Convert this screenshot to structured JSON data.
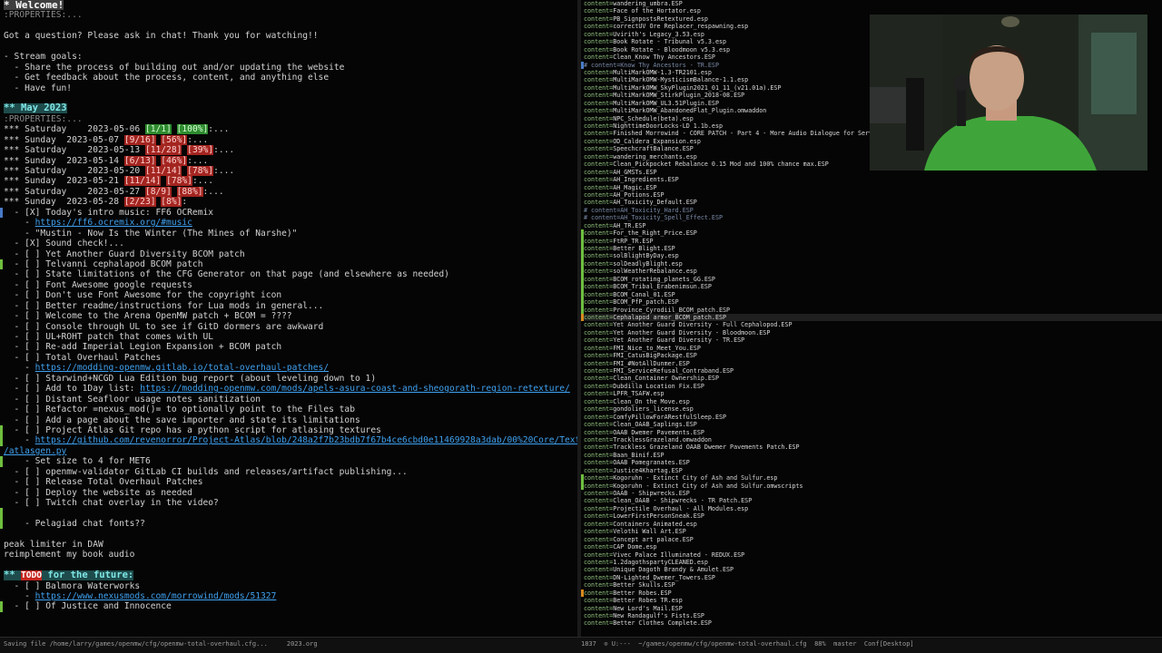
{
  "left": {
    "lines": [
      {
        "parts": [
          {
            "t": "* Welcome!",
            "c": "h1"
          }
        ]
      },
      {
        "parts": [
          {
            "t": ":PROPERTIES:...",
            "c": "dim"
          }
        ]
      },
      {
        "parts": [
          {
            "t": ""
          }
        ]
      },
      {
        "parts": [
          {
            "t": "Got a question? Please ask in chat! Thank you for watching!!"
          }
        ]
      },
      {
        "parts": [
          {
            "t": ""
          }
        ]
      },
      {
        "parts": [
          {
            "t": "- Stream goals:"
          }
        ]
      },
      {
        "parts": [
          {
            "t": "  - Share the process of building out and/or updating the website"
          }
        ]
      },
      {
        "parts": [
          {
            "t": "  - Get feedback about the process, content, and anything else"
          }
        ]
      },
      {
        "parts": [
          {
            "t": "  - Have fun!"
          }
        ]
      },
      {
        "parts": [
          {
            "t": ""
          }
        ]
      },
      {
        "parts": [
          {
            "t": "** May 2023",
            "c": "h2"
          }
        ]
      },
      {
        "parts": [
          {
            "t": ":PROPERTIES:...",
            "c": "dim"
          }
        ]
      },
      {
        "parts": [
          {
            "t": "*** Saturday    2023-05-06 "
          },
          {
            "t": "[1/1]",
            "c": "pct-good"
          },
          {
            "t": " "
          },
          {
            "t": "[100%]",
            "c": "pct-good"
          },
          {
            "t": ":..."
          }
        ]
      },
      {
        "parts": [
          {
            "t": "*** Sunday  2023-05-07 "
          },
          {
            "t": "[9/16]",
            "c": "pct-bad"
          },
          {
            "t": " "
          },
          {
            "t": "[56%]",
            "c": "pct-bad"
          },
          {
            "t": ":..."
          }
        ]
      },
      {
        "parts": [
          {
            "t": "*** Saturday    2023-05-13 "
          },
          {
            "t": "[11/28]",
            "c": "pct-bad"
          },
          {
            "t": " "
          },
          {
            "t": "[39%]",
            "c": "pct-bad"
          },
          {
            "t": ":..."
          }
        ]
      },
      {
        "parts": [
          {
            "t": "*** Sunday  2023-05-14 "
          },
          {
            "t": "[6/13]",
            "c": "pct-bad"
          },
          {
            "t": " "
          },
          {
            "t": "[46%]",
            "c": "pct-bad"
          },
          {
            "t": ":..."
          }
        ]
      },
      {
        "parts": [
          {
            "t": "*** Saturday    2023-05-20 "
          },
          {
            "t": "[11/14]",
            "c": "pct-bad"
          },
          {
            "t": " "
          },
          {
            "t": "[78%]",
            "c": "pct-bad"
          },
          {
            "t": ":..."
          }
        ]
      },
      {
        "parts": [
          {
            "t": "*** Sunday  2023-05-21 "
          },
          {
            "t": "[11/14]",
            "c": "pct-bad"
          },
          {
            "t": " "
          },
          {
            "t": "[78%]",
            "c": "pct-bad"
          },
          {
            "t": ":..."
          }
        ]
      },
      {
        "parts": [
          {
            "t": "*** Saturday    2023-05-27 "
          },
          {
            "t": "[8/9]",
            "c": "pct-bad"
          },
          {
            "t": " "
          },
          {
            "t": "[88%]",
            "c": "pct-bad"
          },
          {
            "t": ":..."
          }
        ]
      },
      {
        "parts": [
          {
            "t": "*** Sunday  2023-05-28 "
          },
          {
            "t": "[2/23]",
            "c": "pct-bad"
          },
          {
            "t": " "
          },
          {
            "t": "[8%]",
            "c": "pct-bad"
          },
          {
            "t": ":"
          }
        ]
      },
      {
        "parts": [
          {
            "t": "  - [X] Today's intro music: FF6 OCRemix"
          }
        ],
        "g": "g-blue"
      },
      {
        "parts": [
          {
            "t": "    - "
          },
          {
            "t": "https://ff6.ocremix.org/#music",
            "c": "link"
          }
        ]
      },
      {
        "parts": [
          {
            "t": "    - \"Mustin - Now Is the Winter (The Mines of Narshe)\""
          }
        ]
      },
      {
        "parts": [
          {
            "t": "  - [X] Sound check!..."
          }
        ]
      },
      {
        "parts": [
          {
            "t": "  - [ ] Yet Another Guard Diversity BCOM patch"
          }
        ]
      },
      {
        "parts": [
          {
            "t": "  - [ ] Telvanni cephalapod BCOM patch"
          }
        ],
        "g": "g-green"
      },
      {
        "parts": [
          {
            "t": "  - [ ] State limitations of the CFG Generator on that page (and elsewhere as needed)"
          }
        ]
      },
      {
        "parts": [
          {
            "t": "  - [ ] Font Awesome google requests"
          }
        ]
      },
      {
        "parts": [
          {
            "t": "  - [ ] Don't use Font Awesome for the copyright icon"
          }
        ]
      },
      {
        "parts": [
          {
            "t": "  - [ ] Better readme/instructions for Lua mods in general..."
          }
        ]
      },
      {
        "parts": [
          {
            "t": "  - [ ] Welcome to the Arena OpenMW patch + BCOM = ????"
          }
        ]
      },
      {
        "parts": [
          {
            "t": "  - [ ] Console through UL to see if GitD dormers are awkward"
          }
        ]
      },
      {
        "parts": [
          {
            "t": "  - [ ] UL+ROHT patch that comes with UL"
          }
        ]
      },
      {
        "parts": [
          {
            "t": "  - [ ] Re-add Imperial Legion Expansion + BCOM patch"
          }
        ]
      },
      {
        "parts": [
          {
            "t": "  - [ ] Total Overhaul Patches"
          }
        ]
      },
      {
        "parts": [
          {
            "t": "    - "
          },
          {
            "t": "https://modding-openmw.gitlab.io/total-overhaul-patches/",
            "c": "link"
          }
        ]
      },
      {
        "parts": [
          {
            "t": "  - [ ] Starwind+NCGD Lua Edition bug report (about leveling down to 1)"
          }
        ]
      },
      {
        "parts": [
          {
            "t": "  - [ ] Add to 1Day list: "
          },
          {
            "t": "https://modding-openmw.com/mods/apels-asura-coast-and-sheogorath-region-retexture/",
            "c": "link"
          }
        ]
      },
      {
        "parts": [
          {
            "t": "  - [ ] Distant Seafloor usage notes sanitization"
          }
        ]
      },
      {
        "parts": [
          {
            "t": "  - [ ] Refactor =nexus_mod()= to optionally point to the Files tab"
          }
        ]
      },
      {
        "parts": [
          {
            "t": "  - [ ] Add a page about the save importer and state its limitations"
          }
        ]
      },
      {
        "parts": [
          {
            "t": "  - [ ] Project Atlas Git repo has a python script for atlasing textures"
          }
        ],
        "g": "g-green"
      },
      {
        "parts": [
          {
            "t": "    - "
          },
          {
            "t": "https://github.com/revenorror/Project-Atlas/blob/248a2f7b23bdb7f67b4ce6cbd0e11469928a3dab/00%20Core/Textures",
            "c": "link"
          }
        ],
        "g": "g-green"
      },
      {
        "parts": [
          {
            "t": "/atlasgen.py",
            "c": "link"
          }
        ]
      },
      {
        "parts": [
          {
            "t": "    - Set size to 4 for MET6"
          }
        ],
        "g": "g-green"
      },
      {
        "parts": [
          {
            "t": "  - [ ] openmw-validator GitLab CI builds and releases/artifact publishing..."
          }
        ]
      },
      {
        "parts": [
          {
            "t": "  - [ ] Release Total Overhaul Patches"
          }
        ]
      },
      {
        "parts": [
          {
            "t": "  - [ ] Deploy the website as needed"
          }
        ]
      },
      {
        "parts": [
          {
            "t": "  - [ ] Twitch chat overlay in the video?"
          }
        ]
      },
      {
        "parts": [
          {
            "t": ""
          }
        ],
        "g": "g-green"
      },
      {
        "parts": [
          {
            "t": "    - Pelagiad chat fonts??"
          }
        ],
        "g": "g-green"
      },
      {
        "parts": [
          {
            "t": ""
          }
        ]
      },
      {
        "parts": [
          {
            "t": "peak limiter in DAW"
          }
        ]
      },
      {
        "parts": [
          {
            "t": "reimplement my book audio"
          }
        ]
      },
      {
        "parts": [
          {
            "t": ""
          }
        ]
      },
      {
        "parts": [
          {
            "t": "** ",
            "c": "h2"
          },
          {
            "t": "TODO",
            "c": "todo"
          },
          {
            "t": " for the future:",
            "c": "h2"
          }
        ]
      },
      {
        "parts": [
          {
            "t": "  - [ ] Balmora Waterworks"
          }
        ]
      },
      {
        "parts": [
          {
            "t": "    - "
          },
          {
            "t": "https://www.nexusmods.com/morrowind/mods/51327",
            "c": "link"
          }
        ]
      },
      {
        "parts": [
          {
            "t": "  - [ ] Of Justice and Innocence"
          }
        ],
        "g": "g-green"
      }
    ]
  },
  "right": {
    "lines": [
      {
        "k": "content=",
        "v": "wandering_umbra.ESP"
      },
      {
        "k": "content=",
        "v": "Face of the Hortator.esp"
      },
      {
        "k": "content=",
        "v": "PB_SignpostsRetextured.esp"
      },
      {
        "k": "content=",
        "v": "correctUV Ore Replacer_respawning.esp"
      },
      {
        "k": "content=",
        "v": "Uvirith's Legacy_3.53.esp"
      },
      {
        "k": "content=",
        "v": "Book Rotate - Tribunal v5.3.esp"
      },
      {
        "k": "content=",
        "v": "Book Rotate - Bloodmoon v5.3.esp"
      },
      {
        "k": "content=",
        "v": "Clean_Know Thy Ancestors.ESP"
      },
      {
        "k": "# content=",
        "v": "Know Thy Ancestors - TR.ESP",
        "comment": true,
        "g": "g-blue"
      },
      {
        "k": "content=",
        "v": "MultiMarkOMW-1.3-TR2101.esp"
      },
      {
        "k": "content=",
        "v": "MultiMarkOMW-MysticismBalance-1.1.esp"
      },
      {
        "k": "content=",
        "v": "MultiMarkOMW_SkyPlugin2021_01_11_(v21.01a).ESP"
      },
      {
        "k": "content=",
        "v": "MultiMarkOMW_StirkPlugin_2018-08.ESP"
      },
      {
        "k": "content=",
        "v": "MultiMarkOMW_UL3.51Plugin.ESP"
      },
      {
        "k": "content=",
        "v": "MultiMarkOMW_AbandonedFlat_Plugin.omwaddon"
      },
      {
        "k": "content=",
        "v": "NPC_Schedule(beta).esp"
      },
      {
        "k": "content=",
        "v": "NighttimeDoorLocks-LD 1.1b.esp"
      },
      {
        "k": "content=",
        "v": "Finished Morrowind - CORE PATCH - Part 4 - More Audio Dialogue for Serv"
      },
      {
        "k": "content=",
        "v": "OD_Caldera_Expansion.esp"
      },
      {
        "k": "content=",
        "v": "SpeechcraftBalance.ESP"
      },
      {
        "k": "content=",
        "v": "wandering_merchants.esp"
      },
      {
        "k": "content=",
        "v": "Clean_Pickpocket Rebalance 0.15 Mod and 100% chance max.ESP"
      },
      {
        "k": "content=",
        "v": "AH_GMSTs.ESP"
      },
      {
        "k": "content=",
        "v": "AH_Ingredients.ESP"
      },
      {
        "k": "content=",
        "v": "AH_Magic.ESP"
      },
      {
        "k": "content=",
        "v": "AH_Potions.ESP"
      },
      {
        "k": "content=",
        "v": "AH_Toxicity_Default.ESP"
      },
      {
        "k": "# content=",
        "v": "AH_Toxicity_Hard.ESP",
        "comment": true
      },
      {
        "k": "# content=",
        "v": "AH_Toxicity_Spell_Effect.ESP",
        "comment": true
      },
      {
        "k": "content=",
        "v": "AH_TR.ESP"
      },
      {
        "k": "content=",
        "v": "For_the_Right_Price.ESP",
        "g": "g-green"
      },
      {
        "k": "content=",
        "v": "FtRP_TR.ESP",
        "g": "g-green"
      },
      {
        "k": "content=",
        "v": "Better Blight.ESP",
        "g": "g-green"
      },
      {
        "k": "content=",
        "v": "solBlightByDay.esp",
        "g": "g-green"
      },
      {
        "k": "content=",
        "v": "solDeadlyBlight.esp",
        "g": "g-green"
      },
      {
        "k": "content=",
        "v": "solWeatherRebalance.esp",
        "g": "g-green"
      },
      {
        "k": "content=",
        "v": "BCOM_rotating_planets_GG.ESP",
        "g": "g-green"
      },
      {
        "k": "content=",
        "v": "BCOM_Tribal_Erabenimsun.ESP",
        "g": "g-green"
      },
      {
        "k": "content=",
        "v": "BCOM_Canal_01.ESP",
        "g": "g-green"
      },
      {
        "k": "content=",
        "v": "BCOM_PfP_patch.ESP",
        "g": "g-green"
      },
      {
        "k": "content=",
        "v": "Province_Cyrodiil_BCOM_patch.ESP",
        "g": "g-green"
      },
      {
        "k": "content=",
        "v": "Cephalapod armor_BCOM_patch.ESP",
        "g": "g-orange",
        "hl": true
      },
      {
        "k": "content=",
        "v": "Yet Another Guard Diversity - Full Cephalopod.ESP"
      },
      {
        "k": "content=",
        "v": "Yet Another Guard Diversity - Bloodmoon.ESP"
      },
      {
        "k": "content=",
        "v": "Yet Another Guard Diversity - TR.ESP"
      },
      {
        "k": "content=",
        "v": "FMI_Nice_to_Meet_You.ESP"
      },
      {
        "k": "content=",
        "v": "FMI_CatusBigPackage.ESP"
      },
      {
        "k": "content=",
        "v": "FMI_#NotAllDunmer.ESP"
      },
      {
        "k": "content=",
        "v": "FMI_ServiceRefusal_Contraband.ESP"
      },
      {
        "k": "content=",
        "v": "Clean_Container Ownership.ESP"
      },
      {
        "k": "content=",
        "v": "Dubdilla Location Fix.ESP"
      },
      {
        "k": "content=",
        "v": "LPFR_TSAFW.esp"
      },
      {
        "k": "content=",
        "v": "Clean_On the Move.esp"
      },
      {
        "k": "content=",
        "v": "gondoliers_license.esp"
      },
      {
        "k": "content=",
        "v": "ComfyPillowForARestfulSleep.ESP"
      },
      {
        "k": "content=",
        "v": "Clean_OAAB_Saplings.ESP"
      },
      {
        "k": "content=",
        "v": "OAAB Dwemer Pavements.ESP"
      },
      {
        "k": "content=",
        "v": "TracklessGrazeland.omwaddon"
      },
      {
        "k": "content=",
        "v": "Trackless Grazeland OAAB Dwemer Pavements Patch.ESP"
      },
      {
        "k": "content=",
        "v": "Baan_Binif.ESP"
      },
      {
        "k": "content=",
        "v": "OAAB Pomegranates.ESP"
      },
      {
        "k": "content=",
        "v": "Justice4Khartag.ESP"
      },
      {
        "k": "content=",
        "v": "Kogoruhn - Extinct City of Ash and Sulfur.esp",
        "g": "g-green"
      },
      {
        "k": "content=",
        "v": "Kogoruhn - Extinct City of Ash and Sulfur.omwscripts",
        "g": "g-green"
      },
      {
        "k": "content=",
        "v": "OAAB - Shipwrecks.ESP"
      },
      {
        "k": "content=",
        "v": "Clean_OAAB - Shipwrecks - TR Patch.ESP"
      },
      {
        "k": "content=",
        "v": "Projectile Overhaul - All Modules.esp"
      },
      {
        "k": "content=",
        "v": "LowerFirstPersonSneak.ESP"
      },
      {
        "k": "content=",
        "v": "Containers Animated.esp"
      },
      {
        "k": "content=",
        "v": "Velothi Wall Art.ESP"
      },
      {
        "k": "content=",
        "v": "Concept art palace.ESP"
      },
      {
        "k": "content=",
        "v": "CAP Dome.esp"
      },
      {
        "k": "content=",
        "v": "Vivec Palace Illuminated - REDUX.ESP"
      },
      {
        "k": "content=",
        "v": "1.2dagothspartyCLEANED.esp"
      },
      {
        "k": "content=",
        "v": "Unique Dagoth Brandy & Amulet.ESP"
      },
      {
        "k": "content=",
        "v": "DN-Lighted_Dwemer_Towers.ESP"
      },
      {
        "k": "content=",
        "v": "Better Skulls.ESP"
      },
      {
        "k": "content=",
        "v": "Better Robes.ESP",
        "g": "g-orange"
      },
      {
        "k": "content=",
        "v": "Better Robes TR.esp"
      },
      {
        "k": "content=",
        "v": "New Lord's Mail.ESP"
      },
      {
        "k": "content=",
        "v": "New Randagulf's Fists.ESP"
      },
      {
        "k": "content=",
        "v": "Better Clothes Complete.ESP"
      }
    ]
  },
  "status_left": "Saving file /home/larry/games/openmw/cfg/openmw-total-overhaul.cfg...     2023.org",
  "status_right": "1837  ⊙ U:---  ~/games/openmw/cfg/openmw-total-overhaul.cfg  88%  master  Conf[Desktop]",
  "colors": {
    "accent_green": "#6fbf3f",
    "link": "#3fa1f0",
    "todo_red": "#c8261f"
  }
}
